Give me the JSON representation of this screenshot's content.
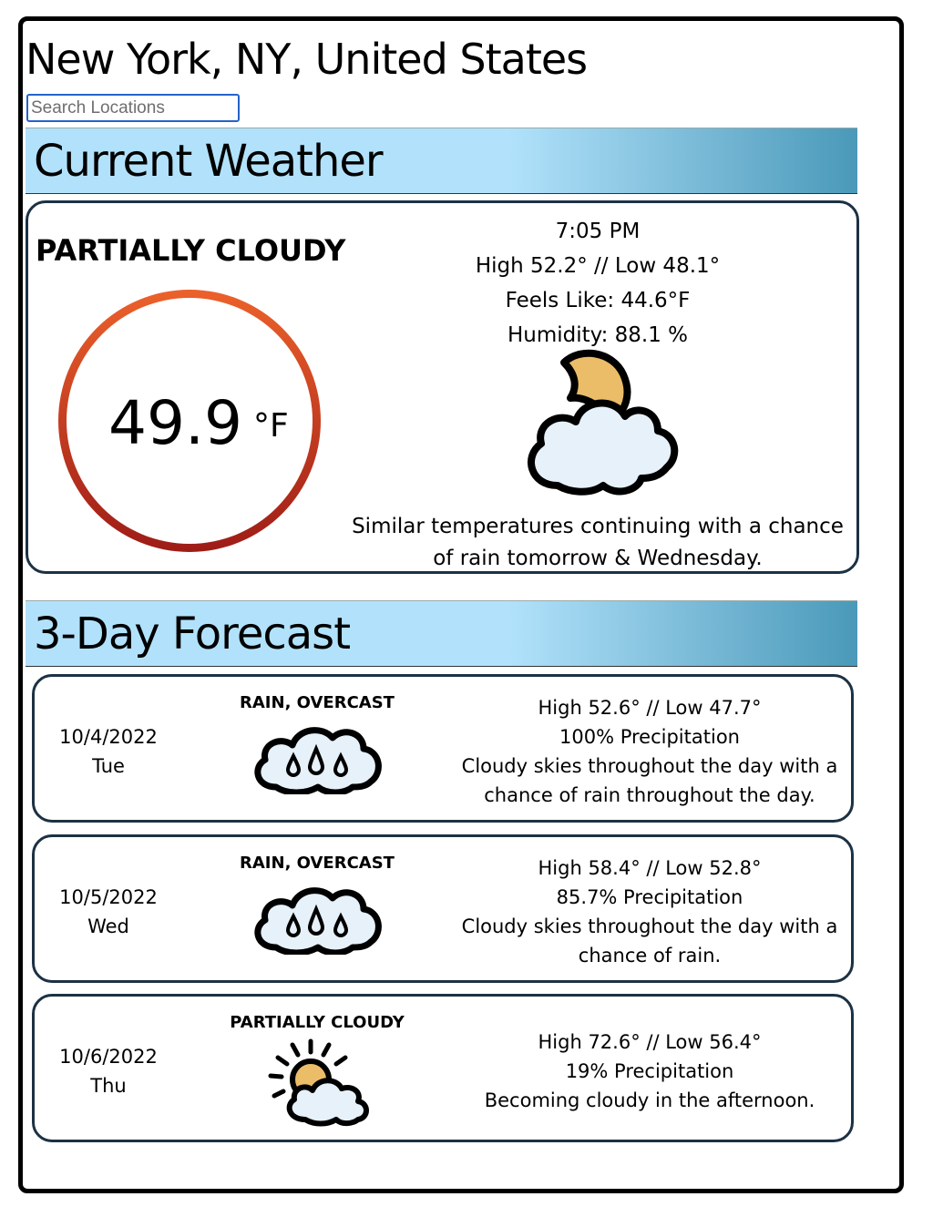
{
  "header": {
    "location": "New York, NY, United States",
    "search_placeholder": "Search Locations"
  },
  "current": {
    "section_title": "Current Weather",
    "condition": "PARTIALLY CLOUDY",
    "temperature": "49.9",
    "unit": "°F",
    "time": "7:05 PM",
    "high_low": "High 52.2° // Low 48.1°",
    "feels_like": "Feels Like: 44.6°F",
    "humidity": "Humidity: 88.1 %",
    "icon": "partly-cloudy-night-icon",
    "summary": "Similar temperatures continuing with a chance of rain tomorrow & Wednesday."
  },
  "forecast": {
    "section_title": "3-Day Forecast",
    "days": [
      {
        "date": "10/4/2022",
        "weekday": "Tue",
        "condition": "RAIN, OVERCAST",
        "icon": "rain-cloud-icon",
        "high_low": "High 52.6° // Low 47.7°",
        "precipitation": "100% Precipitation",
        "description": "Cloudy skies throughout the day with a chance of rain throughout the day."
      },
      {
        "date": "10/5/2022",
        "weekday": "Wed",
        "condition": "RAIN, OVERCAST",
        "icon": "rain-cloud-icon",
        "high_low": "High 58.4° // Low 52.8°",
        "precipitation": "85.7% Precipitation",
        "description": "Cloudy skies throughout the day with a chance of rain."
      },
      {
        "date": "10/6/2022",
        "weekday": "Thu",
        "condition": "PARTIALLY CLOUDY",
        "icon": "partly-cloudy-day-icon",
        "high_low": "High 72.6° // Low 56.4°",
        "precipitation": "19% Precipitation",
        "description": "Becoming cloudy in the afternoon."
      }
    ]
  },
  "colors": {
    "header_gradient_start": "#b2e2fb",
    "header_gradient_end": "#4a99b9",
    "ring_top": "#ec612b",
    "ring_bottom": "#9e1c17",
    "card_border": "#1c3144",
    "icon_fill": "#e6f1fa",
    "moon_sun_fill": "#ebbd69"
  }
}
